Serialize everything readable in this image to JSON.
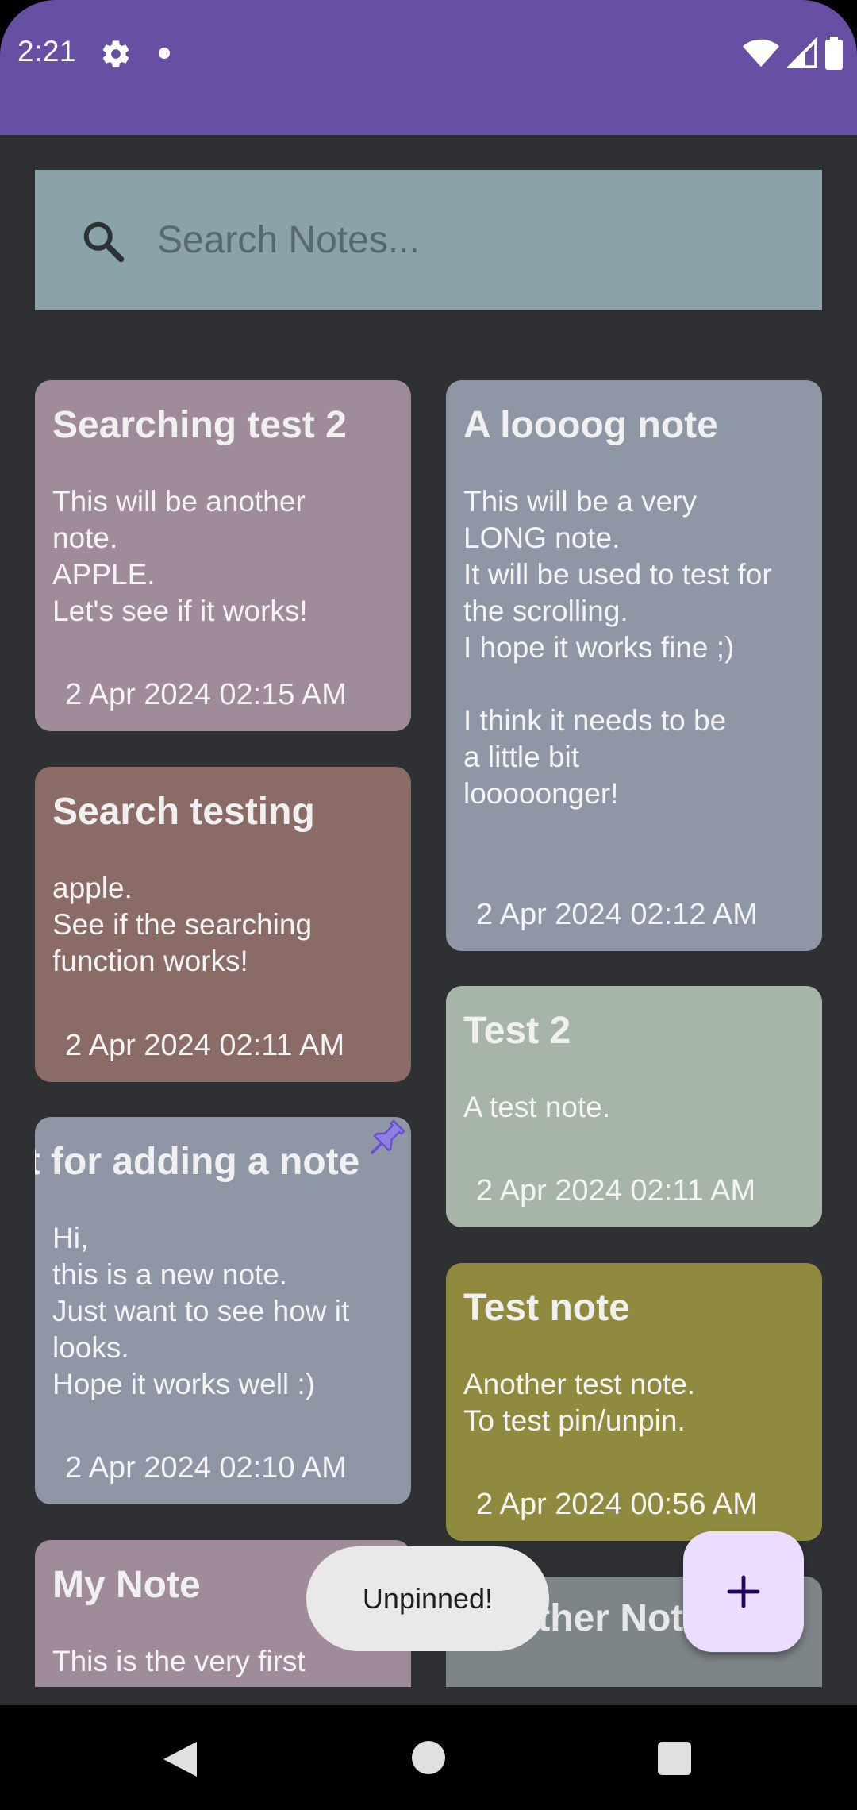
{
  "status_bar": {
    "time": "2:21",
    "icons": [
      "gear-icon",
      "notification-dot",
      "wifi-icon",
      "signal-icon",
      "battery-icon"
    ]
  },
  "colors": {
    "app_bar": "#6750a4",
    "background": "#2f3033",
    "search_bar": "#8aa3a8",
    "fab": "#eaddff"
  },
  "search": {
    "placeholder": "Search Notes...",
    "value": ""
  },
  "notes_left": [
    {
      "title": "Searching test 2",
      "body": "This will be another\nnote.\nAPPLE.\nLet's see if it works!",
      "date": "2 Apr 2024 02:15 AM",
      "color": "#a08b9b"
    },
    {
      "title": "Search testing",
      "body": "apple.\nSee if the searching\nfunction works!",
      "date": "2 Apr 2024 02:11 AM",
      "color": "#8b6b66"
    },
    {
      "title": "st for adding a note",
      "body": "Hi,\nthis is a new note.\nJust want to see how it\nlooks.\nHope it works well :)",
      "date": "2 Apr 2024 02:10 AM",
      "color": "#8f96a6",
      "pinned": true
    },
    {
      "title": "My Note",
      "body": "This is the very first",
      "color": "#a08b9b"
    }
  ],
  "notes_right": [
    {
      "title": "A loooog note",
      "body": "This will be a very\nLONG note.\nIt will be used to test for\nthe scrolling.\nI hope it works fine ;)\n\nI think it needs to be\na little bit\nlooooonger!",
      "date": "2 Apr 2024 02:12 AM",
      "color": "#8f96a6"
    },
    {
      "title": "Test 2",
      "body": "A test note.",
      "date": "2 Apr 2024 02:11 AM",
      "color": "#a6b5a8"
    },
    {
      "title": "Test note",
      "body": "Another test note.\nTo test pin/unpin.",
      "date": "2 Apr 2024 00:56 AM",
      "color": "#8f8a3e"
    },
    {
      "title": "Another Note",
      "color": "#7e8589"
    }
  ],
  "toast": {
    "message": "Unpinned!"
  },
  "fab": {
    "icon": "plus-icon"
  },
  "nav_bar": {
    "buttons": [
      "back-icon",
      "home-icon",
      "recents-icon"
    ]
  }
}
